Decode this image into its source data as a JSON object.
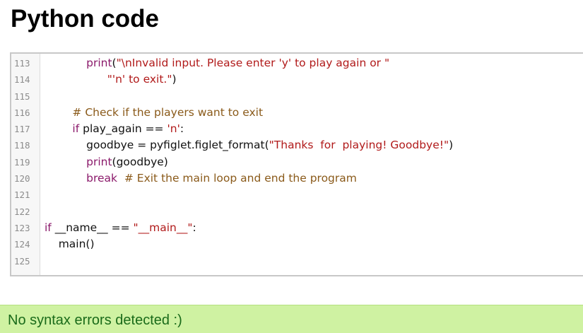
{
  "page": {
    "title": "Python code"
  },
  "editor": {
    "lines": [
      {
        "number": "113",
        "tokens": [
          {
            "t": "            ",
            "k": "plain"
          },
          {
            "t": "print",
            "k": "fn"
          },
          {
            "t": "(",
            "k": "plain"
          },
          {
            "t": "\"\\nInvalid input. Please enter 'y' to play again or \"",
            "k": "str"
          }
        ]
      },
      {
        "number": "114",
        "tokens": [
          {
            "t": "                  ",
            "k": "plain"
          },
          {
            "t": "\"'n' to exit.\"",
            "k": "str"
          },
          {
            "t": ")",
            "k": "plain"
          }
        ]
      },
      {
        "number": "115",
        "tokens": []
      },
      {
        "number": "116",
        "tokens": [
          {
            "t": "        ",
            "k": "plain"
          },
          {
            "t": "# Check if the players want to exit",
            "k": "com"
          }
        ]
      },
      {
        "number": "117",
        "tokens": [
          {
            "t": "        ",
            "k": "plain"
          },
          {
            "t": "if",
            "k": "kw"
          },
          {
            "t": " play_again == ",
            "k": "plain"
          },
          {
            "t": "'n'",
            "k": "str"
          },
          {
            "t": ":",
            "k": "plain"
          }
        ]
      },
      {
        "number": "118",
        "tokens": [
          {
            "t": "            goodbye = pyfiglet.figlet_format(",
            "k": "plain"
          },
          {
            "t": "\"Thanks  for  playing! Goodbye!\"",
            "k": "str"
          },
          {
            "t": ")",
            "k": "plain"
          }
        ]
      },
      {
        "number": "119",
        "tokens": [
          {
            "t": "            ",
            "k": "plain"
          },
          {
            "t": "print",
            "k": "fn"
          },
          {
            "t": "(goodbye)",
            "k": "plain"
          }
        ]
      },
      {
        "number": "120",
        "tokens": [
          {
            "t": "            ",
            "k": "plain"
          },
          {
            "t": "break",
            "k": "kw"
          },
          {
            "t": "  ",
            "k": "plain"
          },
          {
            "t": "# Exit the main loop and end the program",
            "k": "com"
          }
        ]
      },
      {
        "number": "121",
        "tokens": []
      },
      {
        "number": "122",
        "tokens": []
      },
      {
        "number": "123",
        "tokens": [
          {
            "t": "if",
            "k": "kw"
          },
          {
            "t": " __name__ == ",
            "k": "plain"
          },
          {
            "t": "\"__main__\"",
            "k": "str"
          },
          {
            "t": ":",
            "k": "plain"
          }
        ]
      },
      {
        "number": "124",
        "tokens": [
          {
            "t": "    main()",
            "k": "plain"
          }
        ]
      },
      {
        "number": "125",
        "tokens": []
      }
    ]
  },
  "status": {
    "message": "No syntax errors detected :)"
  },
  "colors": {
    "keyword": "#8b1a6b",
    "string": "#b11a1a",
    "comment": "#8a5a1a",
    "status_background": "#cff2a2",
    "status_text": "#1a6b1a"
  }
}
